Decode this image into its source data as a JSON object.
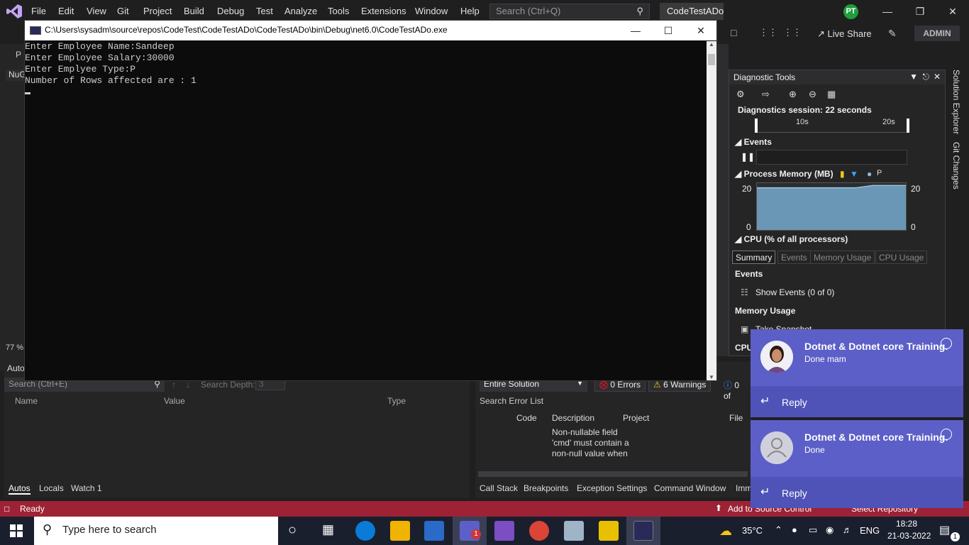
{
  "menu": {
    "items": [
      "File",
      "Edit",
      "View",
      "Git",
      "Project",
      "Build",
      "Debug",
      "Test",
      "Analyze",
      "Tools",
      "Extensions",
      "Window",
      "Help"
    ],
    "search_placeholder": "Search (Ctrl+Q)",
    "solution_name": "CodeTestADo",
    "avatar_initials": "PT"
  },
  "toolbar": {
    "live_share": "Live Share",
    "admin": "ADMIN"
  },
  "left": {
    "nuget_tab": "NuG",
    "zoom": "77 %",
    "p_label": "P"
  },
  "console": {
    "title": "C:\\Users\\sysadm\\source\\repos\\CodeTest\\CodeTestADo\\CodeTestADo\\bin\\Debug\\net6.0\\CodeTestADo.exe",
    "lines": [
      "Enter Employee Name:Sandeep",
      "Enter Employee Salary:30000",
      "Enter Emplyee Type:P",
      "Number of Rows affected are : 1"
    ]
  },
  "diagnostics": {
    "title": "Diagnostic Tools",
    "session": "Diagnostics session: 22 seconds",
    "tick_10s": "10s",
    "tick_20s": "20s",
    "events_label": "Events",
    "process_memory_label": "Process Memory (MB)",
    "legend_p": "P",
    "y_max": "20",
    "y_min": "0",
    "cpu_label": "CPU (% of all processors)",
    "tabs": [
      "Summary",
      "Events",
      "Memory Usage",
      "CPU Usage"
    ],
    "summary_events_header": "Events",
    "show_events": "Show Events (0 of 0)",
    "memory_usage_header": "Memory Usage",
    "take_snapshot": "Take Snapshot",
    "cpu_short": "CPU"
  },
  "solution_explorer_tab": "Solution Explorer",
  "git_changes_tab": "Git Changes",
  "autos": {
    "title": "Autos",
    "search_placeholder": "Search (Ctrl+E)",
    "depth_label": "Search Depth:",
    "depth_value": "3",
    "columns": [
      "Name",
      "Value",
      "Type"
    ],
    "tabs": [
      "Autos",
      "Locals",
      "Watch 1"
    ]
  },
  "errors": {
    "scope": "Entire Solution",
    "errors": "0 Errors",
    "warnings": "6 Warnings",
    "messages": "0 of",
    "search": "Search Error List",
    "columns": [
      "Code",
      "Description",
      "Project",
      "File"
    ],
    "description": "Non-nullable field 'cmd' must contain a non-null value when",
    "tabs": [
      "Call Stack",
      "Breakpoints",
      "Exception Settings",
      "Command Window",
      "Imm"
    ]
  },
  "status": {
    "ready": "Ready",
    "add_source": "Add to Source Control",
    "repo": "Select Repository"
  },
  "toasts": [
    {
      "title": "Dotnet & Dotnet core Training.",
      "message": "Done mam",
      "reply": "Reply"
    },
    {
      "title": "Dotnet & Dotnet core Training.",
      "message": "Done",
      "reply": "Reply"
    }
  ],
  "taskbar": {
    "search_placeholder": "Type here to search",
    "temperature": "35°C",
    "language": "ENG",
    "time": "18:28",
    "date": "21-03-2022",
    "teams_badge": "1",
    "notification_count": "1"
  },
  "memory_chart": {
    "type": "area",
    "values": [
      18,
      18,
      18,
      18,
      18,
      18,
      18,
      19,
      19,
      19
    ],
    "ylim": [
      0,
      20
    ]
  },
  "colors": {
    "status_bar": "#9d2235",
    "toast": "#5b5fc7",
    "teams_accent": "#d13438"
  }
}
